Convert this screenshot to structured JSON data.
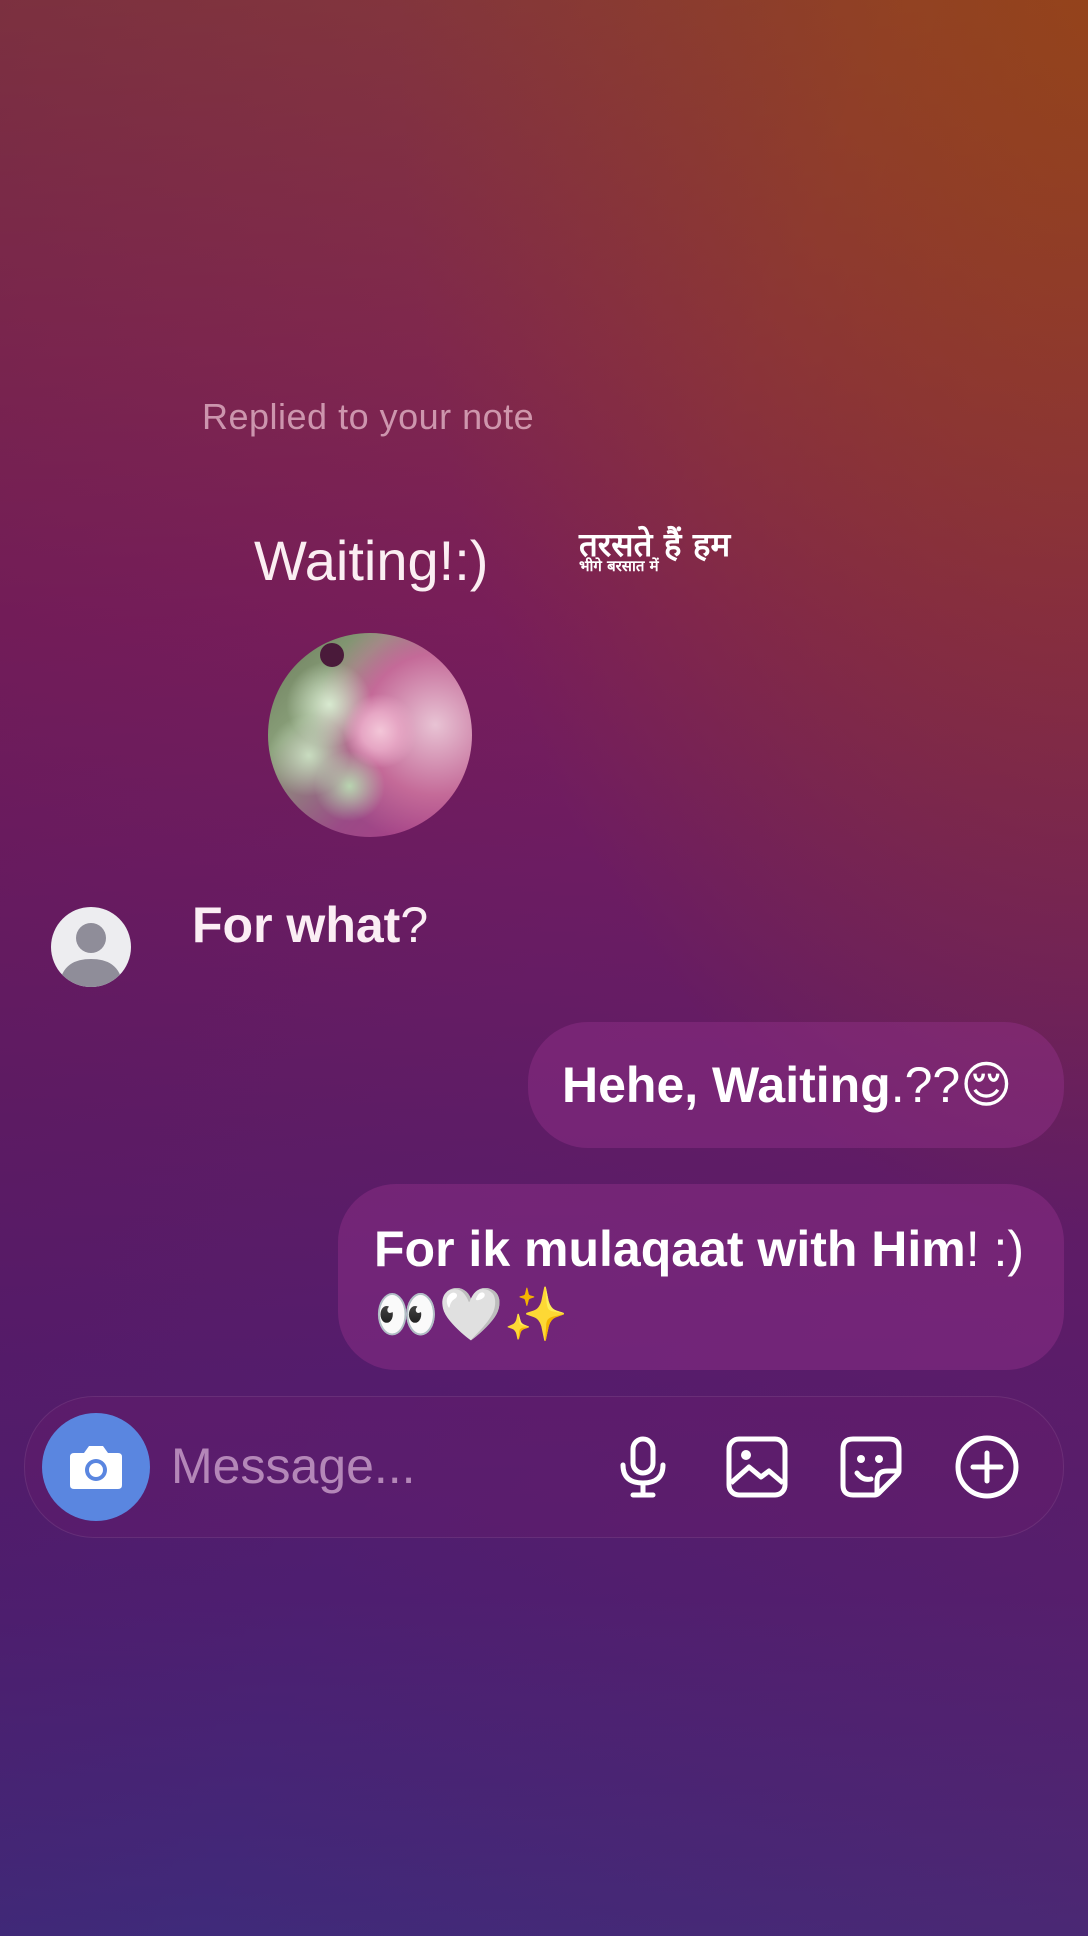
{
  "header": {
    "replied_label": "Replied to your note"
  },
  "note": {
    "text": "Waiting!:)",
    "hindi_line1": "तरसते हैं हम",
    "hindi_line2": "भीगे बरसात में"
  },
  "messages": [
    {
      "direction": "incoming",
      "text_bold": "For what",
      "text_tail": "?"
    },
    {
      "direction": "outgoing",
      "text_bold": "Hehe, Waiting",
      "text_tail": ".??😌"
    },
    {
      "direction": "outgoing",
      "text_bold": "For ik mulaqaat with Him",
      "text_tail": "! :)",
      "emojis": "👀🤍✨"
    }
  ],
  "composer": {
    "placeholder": "Message...",
    "icons": [
      "camera-icon",
      "microphone-icon",
      "gallery-icon",
      "sticker-icon",
      "plus-icon"
    ]
  },
  "colors": {
    "camera_button": "#5a86e0",
    "bubble": "rgba(150,50,140,0.42)",
    "background_top": "#8a3a3a",
    "background_bottom": "#3f2a7a"
  }
}
